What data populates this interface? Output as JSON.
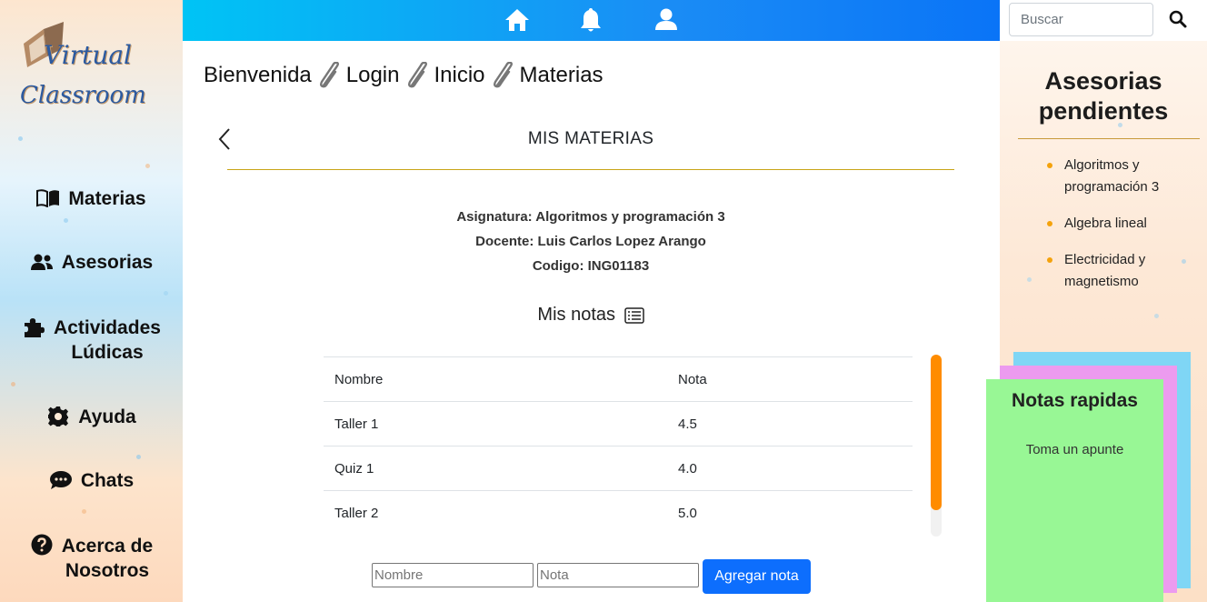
{
  "brand": {
    "line1": "irtual",
    "line1_initial": "V",
    "line2": "lassroom",
    "line2_initial": "C"
  },
  "sidebar": {
    "items": [
      {
        "label": "Materias",
        "icon": "book-icon"
      },
      {
        "label": "Asesorias",
        "icon": "users-icon"
      },
      {
        "label": "Actividades\nLúdicas",
        "icon": "puzzle-icon"
      },
      {
        "label": "Ayuda",
        "icon": "gear-icon"
      },
      {
        "label": "Chats",
        "icon": "chat-icon"
      },
      {
        "label": "Acerca de\nNosotros",
        "icon": "question-icon"
      }
    ]
  },
  "topbar": {
    "icons": [
      "home-icon",
      "bell-icon",
      "user-icon"
    ]
  },
  "search": {
    "placeholder": "Buscar",
    "value": ""
  },
  "breadcrumb": [
    "Bienvenida",
    "Login",
    "Inicio",
    "Materias"
  ],
  "card": {
    "title": "MIS MATERIAS",
    "asignatura": "Asignatura: Algoritmos y programación 3",
    "docente": "Docente: Luis Carlos Lopez Arango",
    "codigo": "Codigo: ING01183",
    "notes_heading": "Mis notas"
  },
  "grades_table": {
    "headers": [
      "Nombre",
      "Nota"
    ],
    "rows": [
      [
        "Taller 1",
        "4.5"
      ],
      [
        "Quiz 1",
        "4.0"
      ],
      [
        "Taller 2",
        "5.0"
      ]
    ]
  },
  "add_form": {
    "name_placeholder": "Nombre",
    "grade_placeholder": "Nota",
    "button_label": "Agregar nota"
  },
  "pending": {
    "title": "Asesorias pendientes",
    "items": [
      "Algoritmos y programación 3",
      "Algebra lineal",
      "Electricidad y magnetismo"
    ]
  },
  "quick_notes": {
    "title": "Notas rapidas",
    "placeholder": "Toma un apunte"
  },
  "colors": {
    "accent_orange": "#ff8c00",
    "button_blue": "#0d6efd",
    "sticky_green": "#98f795",
    "sticky_pink": "#ec9bef",
    "sticky_blue": "#7fd6f5"
  }
}
